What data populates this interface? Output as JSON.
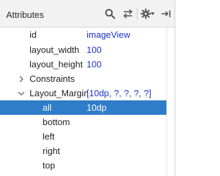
{
  "header": {
    "title": "Attributes",
    "icons": [
      "search-icon",
      "swap-arrows-icon",
      "gear-icon",
      "pin-right-icon"
    ]
  },
  "rows": [
    {
      "label": "id",
      "value": "imageView"
    },
    {
      "label": "layout_width",
      "value": "100"
    },
    {
      "label": "layout_height",
      "value": "100"
    },
    {
      "label": "Constraints",
      "value": ""
    },
    {
      "label": "Layout_Margin",
      "value": "[10dp, ?, ?, ?, ?]"
    },
    {
      "label": "all",
      "value": "10dp"
    },
    {
      "label": "bottom",
      "value": ""
    },
    {
      "label": "left",
      "value": ""
    },
    {
      "label": "right",
      "value": ""
    },
    {
      "label": "top",
      "value": ""
    }
  ],
  "colors": {
    "selection": "#2f7cc8",
    "value_text": "#1a31c8"
  }
}
